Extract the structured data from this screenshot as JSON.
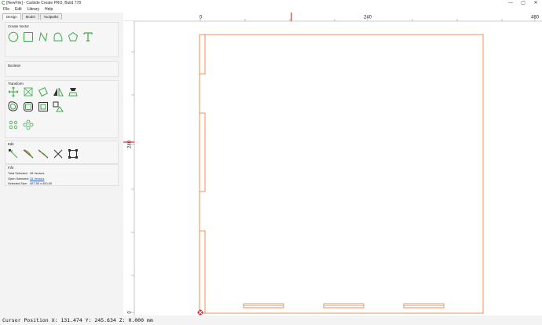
{
  "window": {
    "title": "[NewFile] - Carbide Create PRO, Build 778",
    "controls": {
      "minimize": "—",
      "maximize": "▢",
      "close": "✕"
    }
  },
  "menu": [
    "File",
    "Edit",
    "Library",
    "Help"
  ],
  "tabs": [
    "Design",
    "Model",
    "Toolpaths"
  ],
  "active_tab": "Design",
  "panel": {
    "create_vector": "Create Vector",
    "boolean": "Boolean",
    "transform": "Transform",
    "edit": "Edit",
    "info": "Info"
  },
  "info": {
    "total_selected_label": "Total Selected:",
    "total_selected_value": "28 Vectors",
    "open_selected_label": "Open Selected:",
    "open_selected_value": "28 Vectors",
    "selected_size_label": "Selected Size:",
    "selected_size_value": "407.50 x 400.00"
  },
  "rulers": {
    "top": [
      "0",
      "240",
      "480"
    ],
    "left": [
      "240",
      "0"
    ]
  },
  "status": {
    "cursor": "Cursor Position X: 131.474 Y: 245.634 Z: 0.000 mm"
  },
  "colors": {
    "vector": "#e8742c",
    "tool_icon": "#3daa4a",
    "cursor_marker": "#e0242c"
  }
}
